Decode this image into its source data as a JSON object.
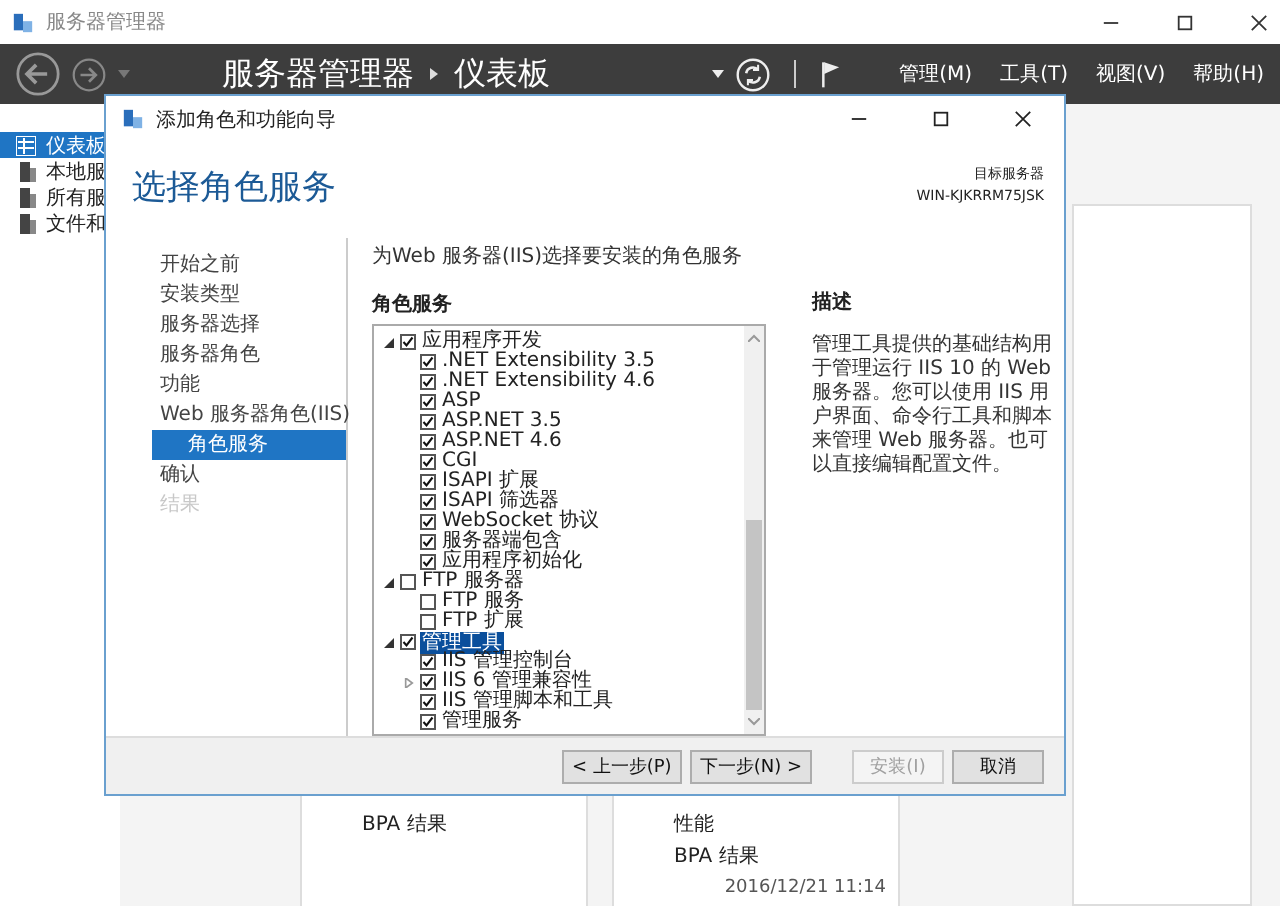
{
  "window": {
    "title": "服务器管理器"
  },
  "header": {
    "breadcrumb": [
      "服务器管理器",
      "仪表板"
    ],
    "menus": [
      "管理(M)",
      "工具(T)",
      "视图(V)",
      "帮助(H)"
    ]
  },
  "sidebar": {
    "items": [
      {
        "label": "仪表板",
        "selected": true
      },
      {
        "label": "本地服",
        "selected": false
      },
      {
        "label": "所有服",
        "selected": false
      },
      {
        "label": "文件和",
        "selected": false
      }
    ]
  },
  "cards": [
    {
      "items": [
        "BPA 结果"
      ]
    },
    {
      "items": [
        "性能",
        "BPA 结果"
      ],
      "timestamp": "2016/12/21 11:14"
    }
  ],
  "dialog": {
    "title": "添加角色和功能向导",
    "heading": "选择角色服务",
    "target_label": "目标服务器",
    "target_server": "WIN-KJKRRM75JSK",
    "nav": [
      {
        "label": "开始之前",
        "selected": false,
        "disabled": false
      },
      {
        "label": "安装类型",
        "selected": false,
        "disabled": false
      },
      {
        "label": "服务器选择",
        "selected": false,
        "disabled": false
      },
      {
        "label": "服务器角色",
        "selected": false,
        "disabled": false
      },
      {
        "label": "功能",
        "selected": false,
        "disabled": false
      },
      {
        "label": "Web 服务器角色(IIS)",
        "selected": false,
        "disabled": false,
        "children": [
          {
            "label": "角色服务",
            "selected": true,
            "disabled": false
          }
        ]
      },
      {
        "label": "确认",
        "selected": false,
        "disabled": false
      },
      {
        "label": "结果",
        "selected": false,
        "disabled": true
      }
    ],
    "intro": "为Web 服务器(IIS)选择要安装的角色服务",
    "tree_label": "角色服务",
    "tree": [
      {
        "label": "应用程序开发",
        "checked": true,
        "expanded": true,
        "selected": false,
        "children": [
          {
            "label": ".NET Extensibility 3.5",
            "checked": true,
            "selected": false
          },
          {
            "label": ".NET Extensibility 4.6",
            "checked": true,
            "selected": false
          },
          {
            "label": "ASP",
            "checked": true,
            "selected": false
          },
          {
            "label": "ASP.NET 3.5",
            "checked": true,
            "selected": false
          },
          {
            "label": "ASP.NET 4.6",
            "checked": true,
            "selected": false
          },
          {
            "label": "CGI",
            "checked": true,
            "selected": false
          },
          {
            "label": "ISAPI 扩展",
            "checked": true,
            "selected": false
          },
          {
            "label": "ISAPI 筛选器",
            "checked": true,
            "selected": false
          },
          {
            "label": "WebSocket 协议",
            "checked": true,
            "selected": false
          },
          {
            "label": "服务器端包含",
            "checked": true,
            "selected": false
          },
          {
            "label": "应用程序初始化",
            "checked": true,
            "selected": false
          }
        ]
      },
      {
        "label": "FTP 服务器",
        "checked": false,
        "expanded": true,
        "selected": false,
        "children": [
          {
            "label": "FTP 服务",
            "checked": false,
            "selected": false
          },
          {
            "label": "FTP 扩展",
            "checked": false,
            "selected": false
          }
        ]
      },
      {
        "label": "管理工具",
        "checked": true,
        "expanded": true,
        "selected": true,
        "children": [
          {
            "label": "IIS 管理控制台",
            "checked": true,
            "selected": false
          },
          {
            "label": "IIS 6 管理兼容性",
            "checked": true,
            "expanded": false,
            "selected": false
          },
          {
            "label": "IIS 管理脚本和工具",
            "checked": true,
            "selected": false
          },
          {
            "label": "管理服务",
            "checked": true,
            "selected": false
          }
        ]
      }
    ],
    "description_label": "描述",
    "description": "管理工具提供的基础结构用于管理运行 IIS 10 的 Web 服务器。您可以使用 IIS 用户界面、命令行工具和脚本来管理 Web 服务器。也可以直接编辑配置文件。",
    "buttons": [
      {
        "label": "< 上一步(P)",
        "disabled": false
      },
      {
        "label": "下一步(N) >",
        "disabled": false
      },
      {
        "label": "安装(I)",
        "disabled": true
      },
      {
        "label": "取消",
        "disabled": false
      }
    ]
  }
}
